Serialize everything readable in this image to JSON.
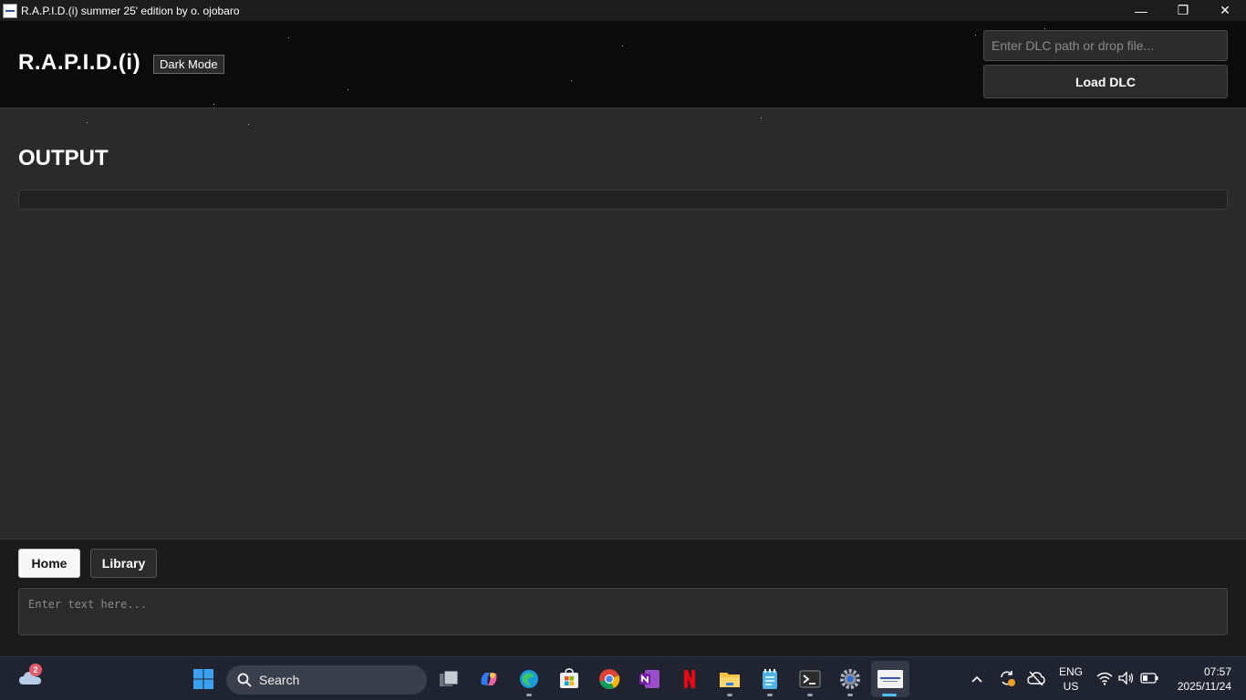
{
  "window": {
    "title": "R.A.P.I.D.(i) summer 25' edition by o. ojobaro",
    "minimize_glyph": "—",
    "maximize_glyph": "❐",
    "close_glyph": "✕"
  },
  "header": {
    "brand": "R.A.P.I.D.(i)",
    "dark_mode_label": "Dark Mode",
    "dlc_placeholder": "Enter DLC path or drop file...",
    "load_label": "Load DLC"
  },
  "main": {
    "output_title": "OUTPUT"
  },
  "bottom": {
    "tabs": [
      {
        "label": "Home",
        "active": true
      },
      {
        "label": "Library",
        "active": false
      }
    ],
    "text_placeholder": "Enter text here..."
  },
  "taskbar": {
    "weather_badge": "2",
    "search_label": "Search",
    "language": "ENG",
    "region": "US",
    "time": "07:57",
    "date": "2025/11/24",
    "pinned_icons": [
      "windows-start-icon",
      "task-view-icon",
      "copilot-icon",
      "edge-icon",
      "store-icon",
      "chrome-icon",
      "onenote-icon",
      "netflix-icon",
      "file-explorer-icon",
      "notepad-icon",
      "terminal-icon",
      "settings-icon",
      "rapid-app-icon"
    ]
  },
  "colors": {
    "header_bg": "#0b0b0b",
    "main_bg": "#2a2a2a",
    "bottom_bg": "#1b1b1b",
    "taskbar_bg": "#1f2430",
    "accent": "#ffffff"
  }
}
